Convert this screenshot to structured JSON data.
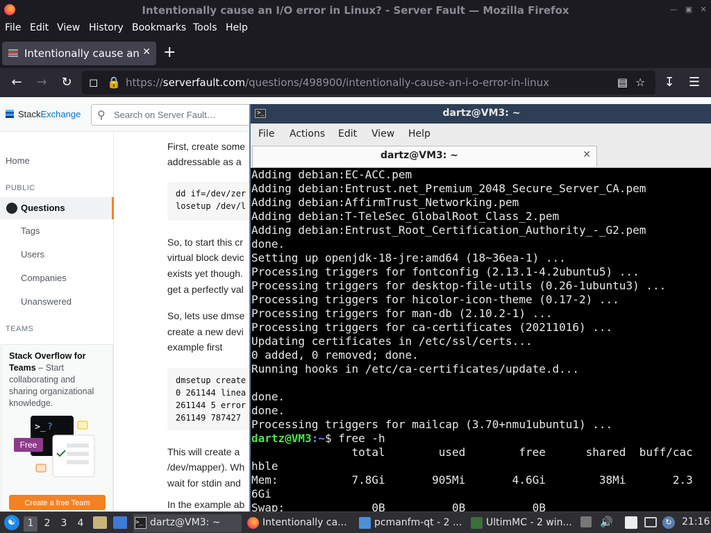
{
  "browser": {
    "window_title": "Intentionally cause an I/O error in Linux? - Server Fault — Mozilla Firefox",
    "menu": [
      "File",
      "Edit",
      "View",
      "History",
      "Bookmarks",
      "Tools",
      "Help"
    ],
    "tab_title": "Intentionally cause an I/O error in Linux? - Server Fault",
    "url_prefix": "https://",
    "url_domain": "serverfault.com",
    "url_path": "/questions/498900/intentionally-cause-an-i-o-error-in-linux",
    "new_tab_label": "+"
  },
  "site": {
    "logo_stack": "Stack",
    "logo_exchange": "Exchange",
    "search_placeholder": "Search on Server Fault…",
    "sidebar": {
      "home": "Home",
      "public_heading": "PUBLIC",
      "questions": "Questions",
      "tags": "Tags",
      "users": "Users",
      "companies": "Companies",
      "unanswered": "Unanswered",
      "teams_heading": "TEAMS",
      "teams_title": "Stack Overflow for Teams",
      "teams_text": " – Start collaborating and sharing organizational knowledge.",
      "teams_badge": "Free",
      "teams_cta": "Create a free Team"
    },
    "content": {
      "p1_l1": "First, create some",
      "p1_l2": "addressable as a",
      "code1_l1": "dd if=/dev/zer",
      "code1_l2": "losetup /dev/l",
      "p2_l1": "So, to start this cr",
      "p2_l2": "virtual block devic",
      "p2_l3": "exists yet though.",
      "p2_l4": "get a perfectly val",
      "p3_l1": "So, lets use dmse",
      "p3_l2": "create a new devi",
      "p3_l3": "example first",
      "code2_l1": "dmsetup create",
      "code2_l2": "0 261144 linea",
      "code2_l3": "261144 5 error",
      "code2_l4": "261149 787427",
      "p4_l1": "This will create a",
      "p4_l2": "/dev/mapper). Wh",
      "p4_l3": "wait for stdin and",
      "p5_l1": "In the example ab"
    }
  },
  "terminal": {
    "title": "dartz@VM3: ~",
    "menu": [
      "File",
      "Actions",
      "Edit",
      "View",
      "Help"
    ],
    "tab_title": "dartz@VM3: ~",
    "lines": [
      "Adding debian:EC-ACC.pem",
      "Adding debian:Entrust.net_Premium_2048_Secure_Server_CA.pem",
      "Adding debian:AffirmTrust_Networking.pem",
      "Adding debian:T-TeleSec_GlobalRoot_Class_2.pem",
      "Adding debian:Entrust_Root_Certification_Authority_-_G2.pem",
      "done.",
      "Setting up openjdk-18-jre:amd64 (18~36ea-1) ...",
      "Processing triggers for fontconfig (2.13.1-4.2ubuntu5) ...",
      "Processing triggers for desktop-file-utils (0.26-1ubuntu3) ...",
      "Processing triggers for hicolor-icon-theme (0.17-2) ...",
      "Processing triggers for man-db (2.10.2-1) ...",
      "Processing triggers for ca-certificates (20211016) ...",
      "Updating certificates in /etc/ssl/certs...",
      "0 added, 0 removed; done.",
      "Running hooks in /etc/ca-certificates/update.d...",
      "",
      "done.",
      "done.",
      "Processing triggers for mailcap (3.70+nmu1ubuntu1) ..."
    ],
    "prompt_user": "dartz@VM3",
    "prompt_path": ":~",
    "prompt_cmd": "$ free -h",
    "out_lines": [
      "               total        used        free      shared  buff/cac",
      "hble",
      "Mem:           7.8Gi       905Mi       4.6Gi        38Mi       2.3",
      "6Gi",
      "Swap:             0B          0B          0B"
    ]
  },
  "taskbar": {
    "workspaces": [
      "1",
      "2",
      "3",
      "4"
    ],
    "tasks": [
      "dartz@VM3: ~",
      "Intentionally ca...",
      "pcmanfm-qt - 2 ...",
      "UltimMC - 2 win..."
    ],
    "clock": "21:16"
  }
}
